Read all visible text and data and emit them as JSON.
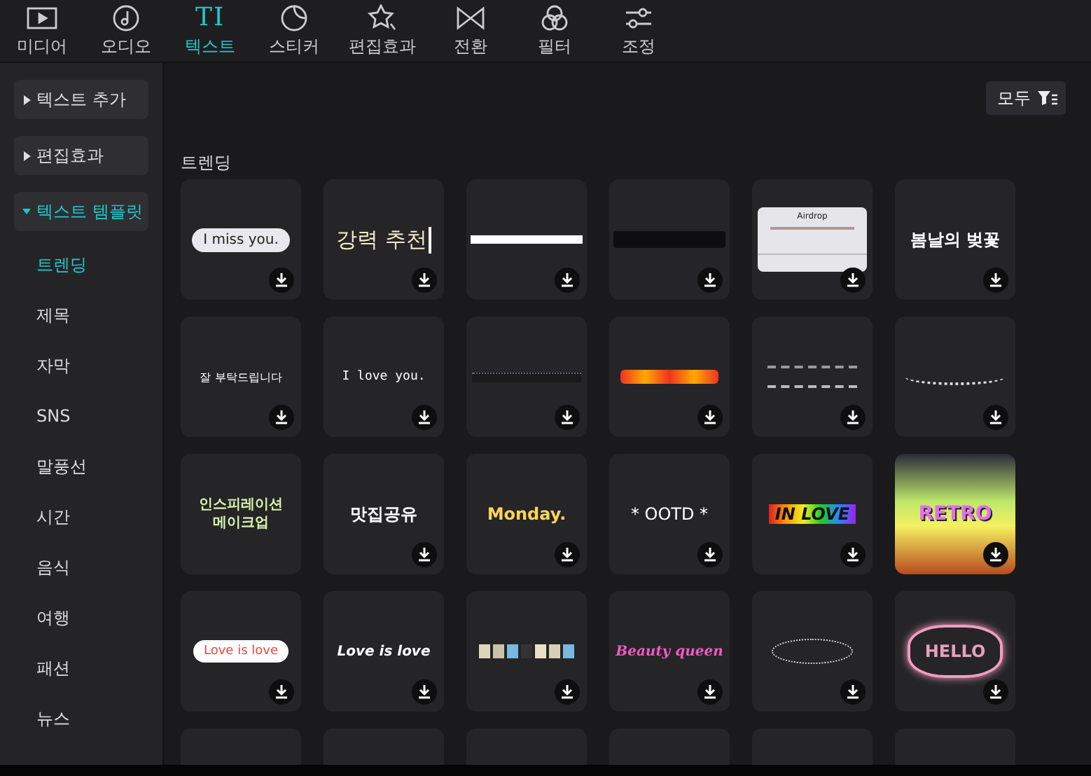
{
  "tabs": [
    {
      "label": "미디어",
      "kind": "media",
      "selected": false
    },
    {
      "label": "오디오",
      "kind": "audio",
      "selected": false
    },
    {
      "label": "텍스트",
      "kind": "glyph",
      "glyph": "TI",
      "selected": true
    },
    {
      "label": "스티커",
      "kind": "sticker",
      "selected": false
    },
    {
      "label": "편집효과",
      "kind": "star",
      "selected": false
    },
    {
      "label": "전환",
      "kind": "transition",
      "selected": false
    },
    {
      "label": "필터",
      "kind": "filter",
      "selected": false
    },
    {
      "label": "조정",
      "kind": "adjust",
      "selected": false
    }
  ],
  "sidebar": {
    "groups": [
      {
        "label": "텍스트 추가",
        "expanded": false
      },
      {
        "label": "편집효과",
        "expanded": false
      },
      {
        "label": "텍스트 템플릿",
        "expanded": true,
        "items": [
          {
            "label": "트렌딩",
            "selected": true
          },
          {
            "label": "제목",
            "selected": false
          },
          {
            "label": "자막",
            "selected": false
          },
          {
            "label": "SNS",
            "selected": false
          },
          {
            "label": "말풍선",
            "selected": false
          },
          {
            "label": "시간",
            "selected": false
          },
          {
            "label": "음식",
            "selected": false
          },
          {
            "label": "여행",
            "selected": false
          },
          {
            "label": "패션",
            "selected": false
          },
          {
            "label": "뉴스",
            "selected": false
          }
        ]
      }
    ]
  },
  "filter_button": {
    "label": "모두"
  },
  "section_title": "트렌딩",
  "tiles": [
    {
      "kind": "bubble",
      "text": "I miss you.",
      "download": true
    },
    {
      "kind": "cursor",
      "text": "강력 추천",
      "download": true
    },
    {
      "kind": "bar",
      "download": true
    },
    {
      "kind": "strip",
      "download": true
    },
    {
      "kind": "dialog",
      "text": "Airdrop",
      "download": true
    },
    {
      "kind": "bold",
      "text": "봄날의 벚꽃",
      "download": true
    },
    {
      "kind": "sparkle",
      "text": "잘 부탁드립니다",
      "download": true
    },
    {
      "kind": "mono",
      "text": "I love you.",
      "download": true
    },
    {
      "kind": "thin-strip",
      "download": true
    },
    {
      "kind": "fire",
      "download": true
    },
    {
      "kind": "chalk",
      "download": true
    },
    {
      "kind": "wavy",
      "download": true
    },
    {
      "kind": "green",
      "text": "인스피레이션 메이크업",
      "download": false
    },
    {
      "kind": "outline",
      "text": "맛집공유",
      "download": true
    },
    {
      "kind": "yellow",
      "text": "Monday.",
      "download": true
    },
    {
      "kind": "plain",
      "text": "* OOTD *",
      "download": true
    },
    {
      "kind": "rainbow",
      "text": "IN LOVE",
      "download": true
    },
    {
      "kind": "retro",
      "text": "RETRO",
      "download": true
    },
    {
      "kind": "pill",
      "text": "Love is love",
      "download": true
    },
    {
      "kind": "italic",
      "text": "Love is love",
      "download": true
    },
    {
      "kind": "blocks",
      "download": true
    },
    {
      "kind": "pink",
      "text": "Beauty queen",
      "download": true
    },
    {
      "kind": "oval",
      "download": true
    },
    {
      "kind": "neon",
      "text": "HELLO",
      "download": true
    },
    {
      "kind": "empty"
    },
    {
      "kind": "empty"
    },
    {
      "kind": "empty"
    },
    {
      "kind": "empty"
    },
    {
      "kind": "empty"
    },
    {
      "kind": "empty"
    }
  ]
}
